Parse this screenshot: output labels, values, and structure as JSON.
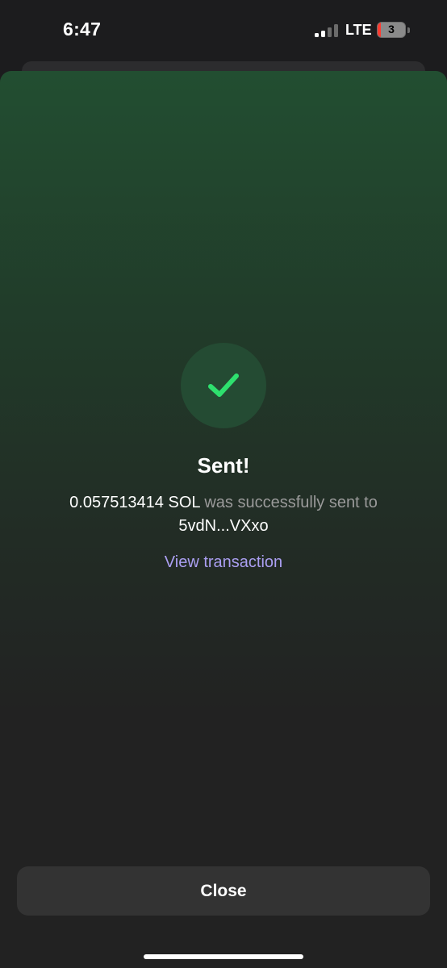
{
  "status_bar": {
    "time": "6:47",
    "network": "LTE",
    "battery_level": "3"
  },
  "success": {
    "title": "Sent!",
    "amount": "0.057513414 SOL",
    "message_middle": " was successfully sent to ",
    "recipient": "5vdN...VXxo",
    "view_transaction_label": "View transaction"
  },
  "footer": {
    "close_label": "Close"
  },
  "colors": {
    "accent_green": "#2ee06e",
    "link_purple": "#ab9ff2",
    "background": "#222222"
  },
  "icons": {
    "success": "checkmark-icon",
    "signal": "signal-icon",
    "battery": "battery-charging-icon"
  }
}
